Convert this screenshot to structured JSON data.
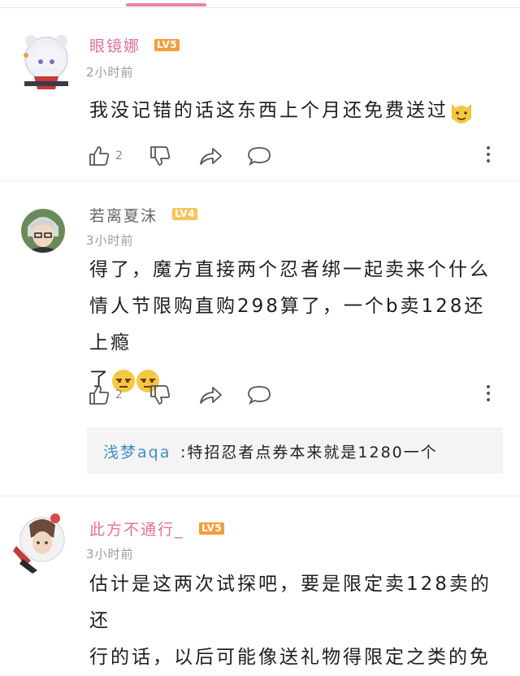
{
  "comments": [
    {
      "username": "眼镜娜",
      "level": "LV5",
      "time": "2小时前",
      "text": "我没记错的话这东西上个月还免费送过",
      "emoji": [
        "cat-face"
      ],
      "likes": "2",
      "username_color": "#e0709a"
    },
    {
      "username": "若离夏沫",
      "level": "LV4",
      "time": "3小时前",
      "lines": [
        "得了，魔方直接两个忍者绑一起卖来个什么",
        "情人节限购直购298算了，一个b卖128还上瘾",
        "了"
      ],
      "emoji": [
        "unamused-face",
        "unamused-face"
      ],
      "likes": "2",
      "username_color": "#666666",
      "reply": {
        "name": "浅梦aqa",
        "text": ":特招忍者点券本来就是1280一个"
      }
    },
    {
      "username": "此方不通行_",
      "level": "LV5",
      "time": "3小时前",
      "lines": [
        "估计是这两次试探吧，要是限定卖128卖的还",
        "行的话，以后可能像送礼物得限定之类的免"
      ],
      "username_color": "#e0709a"
    }
  ],
  "icons": {
    "like": "thumbs-up-icon",
    "dislike": "thumbs-down-icon",
    "share": "share-icon",
    "reply": "comment-bubble-icon",
    "more": "more-vertical-icon"
  },
  "colors": {
    "accent": "#e8859e",
    "level5": "#f59d3c",
    "level4": "#f7c35a"
  }
}
